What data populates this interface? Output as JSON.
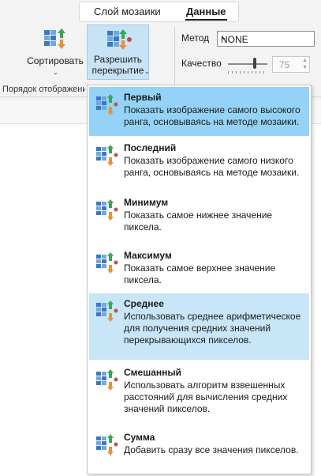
{
  "tabs": {
    "mosaic_layer": "Слой мозаики",
    "data": "Данные"
  },
  "ribbon": {
    "sort_label": "Сортировать",
    "resolve_line1": "Разрешить",
    "resolve_line2": "перекрытие",
    "group_label": "Порядок отображения",
    "method_label": "Метод",
    "method_value": "NONE",
    "quality_label": "Качество",
    "quality_value": "75"
  },
  "menu": {
    "items": [
      {
        "title": "Первый",
        "desc": "Показать изображение самого высокого ранга, основываясь на методе мозаики."
      },
      {
        "title": "Последний",
        "desc": "Показать изображение самого низкого ранга, основываясь на методе мозаики."
      },
      {
        "title": "Минимум",
        "desc": "Показать самое нижнее значение пиксела."
      },
      {
        "title": "Максимум",
        "desc": "Показать самое верхнее значение пиксела."
      },
      {
        "title": "Среднее",
        "desc": "Использовать среднее арифметическое для получения средних значений перекрывающихся пикселов."
      },
      {
        "title": "Смешанный",
        "desc": "Использовать алгоритм взвешенных расстояний для вычисления средних значений пикселов."
      },
      {
        "title": "Сумма",
        "desc": "Добавить сразу все значения пикселов."
      }
    ]
  },
  "colors": {
    "selected": "#94d3f7",
    "hover": "#c8e6f8",
    "button_active": "#c9e3f6",
    "arrow_green": "#3aa655",
    "arrow_orange": "#e8913a",
    "tile_blue": "#3a78c4"
  }
}
